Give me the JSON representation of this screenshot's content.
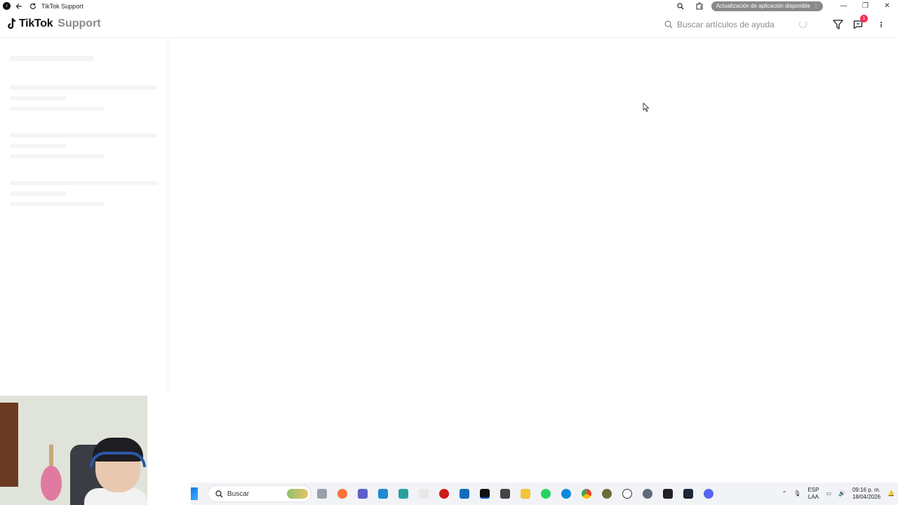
{
  "window": {
    "title": "TikTok Support",
    "update_notice": "Actualización de aplicación disponible"
  },
  "header": {
    "brand": "TikTok",
    "section": "Support",
    "search_placeholder": "Buscar artículos de ayuda",
    "notifications_badge": "1"
  },
  "taskbar": {
    "search_label": "Buscar",
    "language_top": "ESP",
    "language_bottom": "LAA",
    "time": "09:16 p. m.",
    "date": "18/04/2026"
  },
  "colors": {
    "accent": "#fe2c55",
    "muted_text": "#8a8b91",
    "skeleton": "#f5f5f6"
  },
  "icons": {
    "back": "arrow-left-icon",
    "reload": "reload-icon",
    "zoom": "magnifier-icon",
    "extensions": "puzzle-icon",
    "filter": "filter-icon",
    "feedback": "message-icon",
    "more": "more-vertical-icon"
  }
}
